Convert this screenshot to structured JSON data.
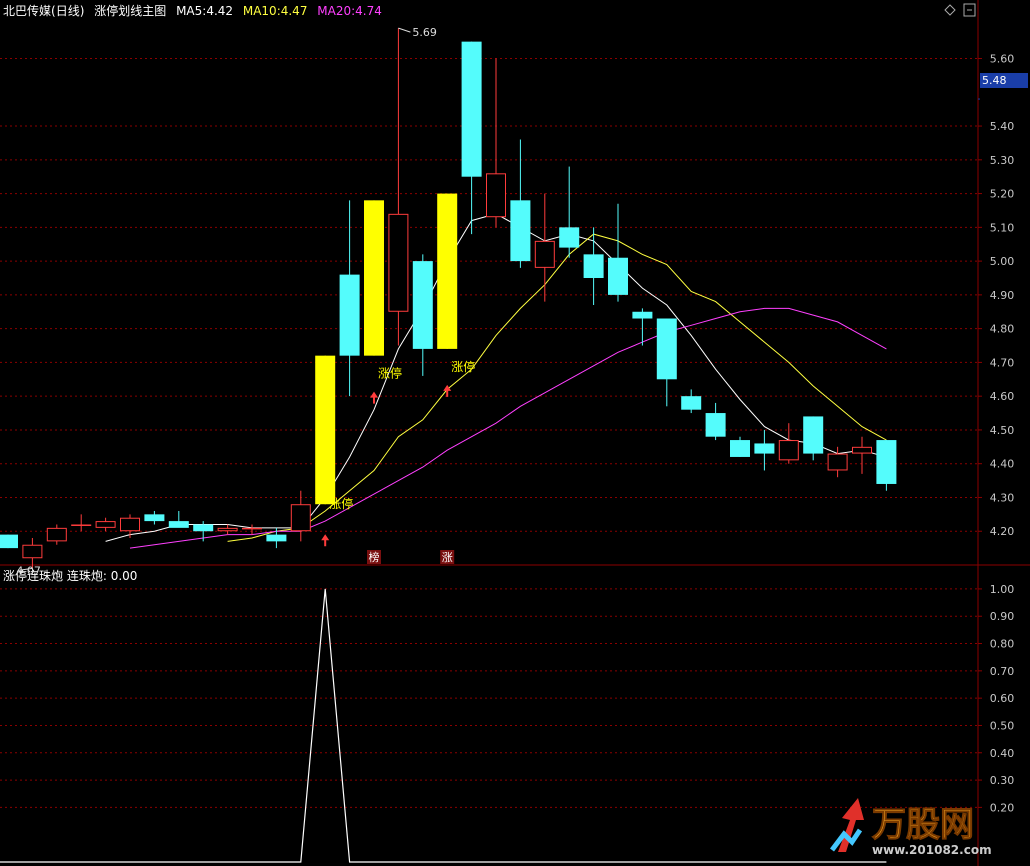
{
  "header": {
    "stock": "北巴传媒",
    "period": "(日线)",
    "indicator": "涨停划线主图",
    "ma5_label": "MA5:",
    "ma5_value": "4.42",
    "ma10_label": "MA10:",
    "ma10_value": "4.47",
    "ma20_label": "MA20:",
    "ma20_value": "4.74"
  },
  "sub_header": {
    "indicator": "涨停连珠炮",
    "series_label": "连珠炮:",
    "series_value": "0.00"
  },
  "current_price": "5.48",
  "colors": {
    "up": "#ff3c3c",
    "down": "#54fcfc",
    "limit_up": "#ffff00",
    "ma5": "#ffffff",
    "ma10": "#ffff40",
    "ma20": "#ff40ff",
    "grid": "#8b0000",
    "axis_text": "#c8c8c8"
  },
  "chart_data": [
    {
      "type": "candlestick",
      "yticks": [
        "4.20",
        "4.30",
        "4.40",
        "4.50",
        "4.60",
        "4.70",
        "4.80",
        "4.90",
        "5.00",
        "5.10",
        "5.20",
        "5.30",
        "5.40",
        "5.60"
      ],
      "ylim": [
        4.1,
        5.72
      ],
      "max_label": "5.69",
      "min_label": "4.07",
      "annotations": [
        {
          "text": "涨停",
          "bar": 13
        },
        {
          "text": "涨停",
          "bar": 15
        },
        {
          "text": "涨停",
          "bar": 18
        }
      ],
      "bottom_markers": [
        {
          "text": "榜",
          "bar": 15
        },
        {
          "text": "涨",
          "bar": 18
        }
      ],
      "arrow_bars": [
        13,
        15,
        18
      ],
      "candles": [
        {
          "o": 4.19,
          "h": 4.19,
          "l": 4.15,
          "c": 4.15,
          "k": "down"
        },
        {
          "o": 4.12,
          "h": 4.18,
          "l": 4.09,
          "c": 4.16,
          "k": "up"
        },
        {
          "o": 4.17,
          "h": 4.22,
          "l": 4.16,
          "c": 4.21,
          "k": "up"
        },
        {
          "o": 4.22,
          "h": 4.25,
          "l": 4.2,
          "c": 4.22,
          "k": "up"
        },
        {
          "o": 4.21,
          "h": 4.24,
          "l": 4.2,
          "c": 4.23,
          "k": "up"
        },
        {
          "o": 4.2,
          "h": 4.25,
          "l": 4.18,
          "c": 4.24,
          "k": "up"
        },
        {
          "o": 4.25,
          "h": 4.26,
          "l": 4.22,
          "c": 4.23,
          "k": "down"
        },
        {
          "o": 4.23,
          "h": 4.26,
          "l": 4.22,
          "c": 4.21,
          "k": "down"
        },
        {
          "o": 4.22,
          "h": 4.23,
          "l": 4.17,
          "c": 4.2,
          "k": "down"
        },
        {
          "o": 4.2,
          "h": 4.22,
          "l": 4.19,
          "c": 4.21,
          "k": "up"
        },
        {
          "o": 4.21,
          "h": 4.22,
          "l": 4.19,
          "c": 4.21,
          "k": "up"
        },
        {
          "o": 4.19,
          "h": 4.21,
          "l": 4.15,
          "c": 4.17,
          "k": "down"
        },
        {
          "o": 4.2,
          "h": 4.32,
          "l": 4.17,
          "c": 4.28,
          "k": "up"
        },
        {
          "o": 4.28,
          "h": 4.72,
          "l": 4.28,
          "c": 4.72,
          "k": "limit"
        },
        {
          "o": 4.72,
          "h": 5.18,
          "l": 4.6,
          "c": 4.96,
          "k": "down"
        },
        {
          "o": 4.72,
          "h": 5.18,
          "l": 4.72,
          "c": 5.18,
          "k": "limit"
        },
        {
          "o": 4.85,
          "h": 5.69,
          "l": 4.75,
          "c": 5.14,
          "k": "up"
        },
        {
          "o": 5.0,
          "h": 5.02,
          "l": 4.66,
          "c": 4.74,
          "k": "down"
        },
        {
          "o": 4.74,
          "h": 5.2,
          "l": 4.74,
          "c": 5.2,
          "k": "limit"
        },
        {
          "o": 5.65,
          "h": 5.65,
          "l": 5.08,
          "c": 5.25,
          "k": "down"
        },
        {
          "o": 5.26,
          "h": 5.6,
          "l": 5.1,
          "c": 5.13,
          "k": "up"
        },
        {
          "o": 5.18,
          "h": 5.36,
          "l": 4.98,
          "c": 5.0,
          "k": "down"
        },
        {
          "o": 4.98,
          "h": 5.2,
          "l": 4.88,
          "c": 5.06,
          "k": "up"
        },
        {
          "o": 5.1,
          "h": 5.28,
          "l": 5.01,
          "c": 5.04,
          "k": "down"
        },
        {
          "o": 5.02,
          "h": 5.1,
          "l": 4.87,
          "c": 4.95,
          "k": "down"
        },
        {
          "o": 5.01,
          "h": 5.17,
          "l": 4.88,
          "c": 4.9,
          "k": "down"
        },
        {
          "o": 4.85,
          "h": 4.86,
          "l": 4.75,
          "c": 4.83,
          "k": "down"
        },
        {
          "o": 4.83,
          "h": 4.83,
          "l": 4.57,
          "c": 4.65,
          "k": "down"
        },
        {
          "o": 4.6,
          "h": 4.62,
          "l": 4.55,
          "c": 4.56,
          "k": "down"
        },
        {
          "o": 4.55,
          "h": 4.58,
          "l": 4.47,
          "c": 4.48,
          "k": "down"
        },
        {
          "o": 4.47,
          "h": 4.48,
          "l": 4.42,
          "c": 4.42,
          "k": "down"
        },
        {
          "o": 4.46,
          "h": 4.5,
          "l": 4.38,
          "c": 4.43,
          "k": "down"
        },
        {
          "o": 4.41,
          "h": 4.52,
          "l": 4.4,
          "c": 4.47,
          "k": "up"
        },
        {
          "o": 4.54,
          "h": 4.54,
          "l": 4.41,
          "c": 4.43,
          "k": "down"
        },
        {
          "o": 4.38,
          "h": 4.45,
          "l": 4.36,
          "c": 4.43,
          "k": "up"
        },
        {
          "o": 4.43,
          "h": 4.48,
          "l": 4.37,
          "c": 4.45,
          "k": "up"
        },
        {
          "o": 4.47,
          "h": 4.47,
          "l": 4.32,
          "c": 4.34,
          "k": "down"
        }
      ],
      "series": [
        {
          "name": "MA5",
          "values": [
            null,
            null,
            null,
            null,
            4.17,
            4.19,
            4.2,
            4.22,
            4.22,
            4.22,
            4.21,
            4.21,
            4.21,
            4.3,
            4.42,
            4.56,
            4.74,
            4.86,
            5.0,
            5.12,
            5.14,
            5.1,
            5.06,
            5.08,
            5.06,
            4.99,
            4.92,
            4.87,
            4.78,
            4.68,
            4.59,
            4.51,
            4.47,
            4.46,
            4.43,
            4.44,
            4.42
          ]
        },
        {
          "name": "MA10",
          "values": [
            null,
            null,
            null,
            null,
            null,
            null,
            null,
            null,
            null,
            4.17,
            4.18,
            4.2,
            4.21,
            4.26,
            4.32,
            4.38,
            4.48,
            4.53,
            4.62,
            4.68,
            4.78,
            4.86,
            4.93,
            5.02,
            5.08,
            5.06,
            5.02,
            4.99,
            4.91,
            4.88,
            4.82,
            4.76,
            4.7,
            4.63,
            4.57,
            4.51,
            4.47
          ]
        },
        {
          "name": "MA20",
          "values": [
            null,
            null,
            null,
            null,
            null,
            4.15,
            4.16,
            4.17,
            4.18,
            4.19,
            4.19,
            4.2,
            4.2,
            4.23,
            4.27,
            4.31,
            4.35,
            4.39,
            4.44,
            4.48,
            4.52,
            4.57,
            4.61,
            4.65,
            4.69,
            4.73,
            4.76,
            4.79,
            4.81,
            4.83,
            4.85,
            4.86,
            4.86,
            4.84,
            4.82,
            4.78,
            4.74
          ]
        }
      ]
    },
    {
      "type": "line",
      "name": "连珠炮",
      "yticks": [
        "0.20",
        "0.30",
        "0.40",
        "0.50",
        "0.60",
        "0.70",
        "0.80",
        "0.90",
        "1.00"
      ],
      "ylim": [
        0,
        1.04
      ],
      "values": [
        0,
        0,
        0,
        0,
        0,
        0,
        0,
        0,
        0,
        0,
        0,
        0,
        0,
        1,
        0,
        0,
        0,
        0,
        0,
        0,
        0,
        0,
        0,
        0,
        0,
        0,
        0,
        0,
        0,
        0,
        0,
        0,
        0,
        0,
        0,
        0,
        0
      ]
    }
  ],
  "watermark": {
    "brand": "万股网",
    "url": "www.201082.com"
  }
}
